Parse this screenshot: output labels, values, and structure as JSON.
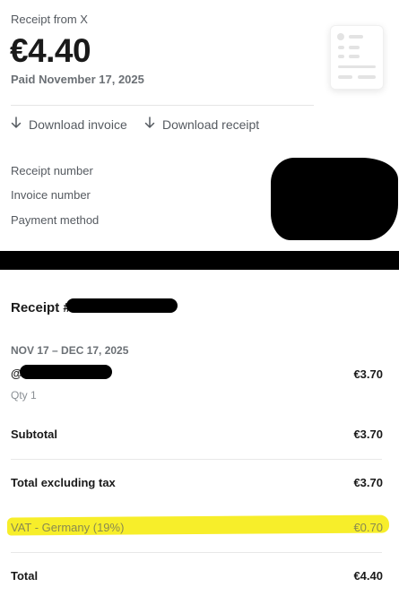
{
  "header": {
    "receipt_from": "Receipt from X",
    "amount": "€4.40",
    "paid_date": "Paid November 17, 2025"
  },
  "actions": {
    "download_invoice": "Download invoice",
    "download_receipt": "Download receipt"
  },
  "info": {
    "receipt_number_label": "Receipt number",
    "invoice_number_label": "Invoice number",
    "payment_method_label": "Payment method"
  },
  "receipt": {
    "title": "Receipt #",
    "period": "NOV 17 – DEC 17, 2025",
    "item_prefix": "@",
    "item_price": "€3.70",
    "item_qty": "Qty 1"
  },
  "summary": {
    "subtotal_label": "Subtotal",
    "subtotal_value": "€3.70",
    "excl_tax_label": "Total excluding tax",
    "excl_tax_value": "€3.70",
    "vat_label": "VAT - Germany (19%)",
    "vat_value": "€0.70",
    "total_label": "Total",
    "total_value": "€4.40"
  },
  "colors": {
    "highlight": "#f7ee2a",
    "redaction": "#000000"
  }
}
